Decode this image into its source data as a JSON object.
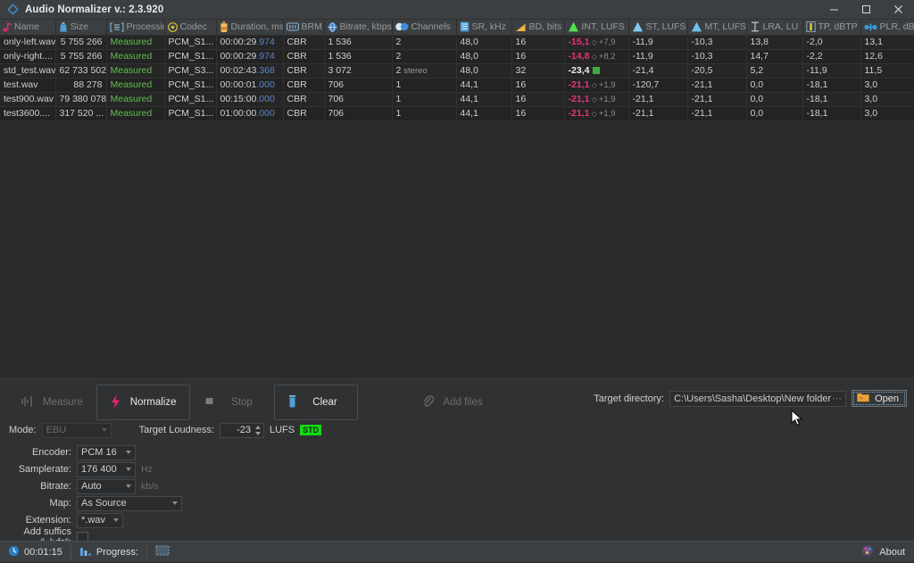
{
  "window": {
    "title": "Audio Normalizer v.: 2.3.920",
    "app_icon": "diamond-icon",
    "minimize_label": "—",
    "maximize_label": "□",
    "close_label": "✕",
    "accent": "#2f8fd4"
  },
  "table": {
    "columns": [
      {
        "label": "Name",
        "icon": "music-note-icon",
        "width": 62,
        "align": "left"
      },
      {
        "label": "Size",
        "icon": "size-icon",
        "width": 57,
        "align": "right"
      },
      {
        "label": "Processing",
        "icon": "processing-icon",
        "width": 65,
        "align": "left"
      },
      {
        "label": "Codec",
        "icon": "codec-icon",
        "width": 58,
        "align": "left"
      },
      {
        "label": "Duration, ms",
        "icon": "duration-icon",
        "width": 75,
        "align": "left"
      },
      {
        "label": "BRM",
        "icon": "brm-icon",
        "width": 46,
        "align": "left"
      },
      {
        "label": "Bitrate, kbps",
        "icon": "bitrate-icon",
        "width": 76,
        "align": "left"
      },
      {
        "label": "Channels",
        "icon": "channels-icon",
        "width": 72,
        "align": "left"
      },
      {
        "label": "SR, kHz",
        "icon": "sr-icon",
        "width": 62,
        "align": "left"
      },
      {
        "label": "BD, bits",
        "icon": "bd-icon",
        "width": 59,
        "align": "left"
      },
      {
        "label": "INT, LUFS",
        "icon": "int-icon",
        "width": 72,
        "align": "left"
      },
      {
        "label": "ST, LUFS",
        "icon": "st-icon",
        "width": 66,
        "align": "left"
      },
      {
        "label": "MT, LUFS",
        "icon": "mt-icon",
        "width": 66,
        "align": "left"
      },
      {
        "label": "LRA, LU",
        "icon": "lra-icon",
        "width": 63,
        "align": "left"
      },
      {
        "label": "TP, dBTP",
        "icon": "tp-icon",
        "width": 65,
        "align": "left"
      },
      {
        "label": "PLR, dB",
        "icon": "plr-icon",
        "width": 60,
        "align": "left"
      }
    ],
    "rows": [
      {
        "name": "only-left.wav",
        "size": "5 755 266",
        "processing": "Measured",
        "codec": "PCM_S1...",
        "duration": "00:00:29",
        "duration_ms": "974",
        "brm": "CBR",
        "bitrate": "1 536",
        "channels": "2",
        "channels_sub": "",
        "sr": "48,0",
        "bd": "16",
        "int": "-15,1",
        "int_state": "pending",
        "int_delta": "+7,9",
        "st": "-11,9",
        "mt": "-10,3",
        "lra": "13,8",
        "tp": "-2,0",
        "plr": "13,1"
      },
      {
        "name": "only-right....",
        "size": "5 755 266",
        "processing": "Measured",
        "codec": "PCM_S1...",
        "duration": "00:00:29",
        "duration_ms": "974",
        "brm": "CBR",
        "bitrate": "1 536",
        "channels": "2",
        "channels_sub": "",
        "sr": "48,0",
        "bd": "16",
        "int": "-14,8",
        "int_state": "pending",
        "int_delta": "+8,2",
        "st": "-11,9",
        "mt": "-10,3",
        "lra": "14,7",
        "tp": "-2,2",
        "plr": "12,6"
      },
      {
        "name": "std_test.wav",
        "size": "62 733 502",
        "processing": "Measured",
        "codec": "PCM_S3...",
        "duration": "00:02:43",
        "duration_ms": "368",
        "brm": "CBR",
        "bitrate": "3 072",
        "channels": "2",
        "channels_sub": "stereo",
        "sr": "48,0",
        "bd": "32",
        "int": "-23,4",
        "int_state": "ok",
        "int_delta": "",
        "st": "-21,4",
        "mt": "-20,5",
        "lra": "5,2",
        "tp": "-11,9",
        "plr": "11,5"
      },
      {
        "name": "test.wav",
        "size": "88 278",
        "processing": "Measured",
        "codec": "PCM_S1...",
        "duration": "00:00:01",
        "duration_ms": "000",
        "brm": "CBR",
        "bitrate": "706",
        "channels": "1",
        "channels_sub": "",
        "sr": "44,1",
        "bd": "16",
        "int": "-21,1",
        "int_state": "pending",
        "int_delta": "+1,9",
        "st": "-120,7",
        "mt": "-21,1",
        "lra": "0,0",
        "tp": "-18,1",
        "plr": "3,0"
      },
      {
        "name": "test900.wav",
        "size": "79 380 078",
        "processing": "Measured",
        "codec": "PCM_S1...",
        "duration": "00:15:00",
        "duration_ms": "000",
        "brm": "CBR",
        "bitrate": "706",
        "channels": "1",
        "channels_sub": "",
        "sr": "44,1",
        "bd": "16",
        "int": "-21,1",
        "int_state": "pending",
        "int_delta": "+1,9",
        "st": "-21,1",
        "mt": "-21,1",
        "lra": "0,0",
        "tp": "-18,1",
        "plr": "3,0"
      },
      {
        "name": "test3600....",
        "size": "317 520 ...",
        "processing": "Measured",
        "codec": "PCM_S1...",
        "duration": "01:00:00",
        "duration_ms": "000",
        "brm": "CBR",
        "bitrate": "706",
        "channels": "1",
        "channels_sub": "",
        "sr": "44,1",
        "bd": "16",
        "int": "-21,1",
        "int_state": "pending",
        "int_delta": "+1,9",
        "st": "-21,1",
        "mt": "-21,1",
        "lra": "0,0",
        "tp": "-18,1",
        "plr": "3,0"
      }
    ]
  },
  "actions": {
    "measure": {
      "label": "Measure",
      "icon": "waveform-icon",
      "enabled": false
    },
    "normalize": {
      "label": "Normalize",
      "icon": "lightning-icon",
      "enabled": true
    },
    "stop": {
      "label": "Stop",
      "icon": "stop-square-icon",
      "enabled": false
    },
    "clear": {
      "label": "Clear",
      "icon": "trash-icon",
      "enabled": true
    },
    "add_files": {
      "label": "Add files",
      "icon": "paperclip-icon",
      "enabled": false
    }
  },
  "mode_row": {
    "mode_label": "Mode:",
    "mode_value": "EBU",
    "target_loudness_label": "Target Loudness:",
    "target_loudness_value": "-23",
    "lufs_label": "LUFS",
    "std_badge": "STD"
  },
  "settings": {
    "encoder": {
      "label": "Encoder:",
      "value": "PCM 16",
      "unit": ""
    },
    "samplerate": {
      "label": "Samplerate:",
      "value": "176 400",
      "unit": "Hz"
    },
    "bitrate": {
      "label": "Bitrate:",
      "value": "Auto",
      "unit": "kb/s"
    },
    "map": {
      "label": "Map:",
      "value": "As Source",
      "unit": ""
    },
    "extension": {
      "label": "Extension:",
      "value": "*.wav",
      "unit": ""
    },
    "suffix": {
      "label": "Add suffics \"_lufs\":",
      "checked": false
    }
  },
  "target_directory": {
    "label": "Target directory:",
    "path": "C:\\Users\\Sasha\\Desktop\\New folder",
    "ellipsis": "···",
    "open_label": "Open",
    "folder_icon": "folder-icon"
  },
  "statusbar": {
    "clock_icon": "clock-icon",
    "time": "00:01:15",
    "progress_icon": "bars-icon",
    "progress_label": "Progress:",
    "about_label": "About",
    "about_icon": "about-icon"
  }
}
